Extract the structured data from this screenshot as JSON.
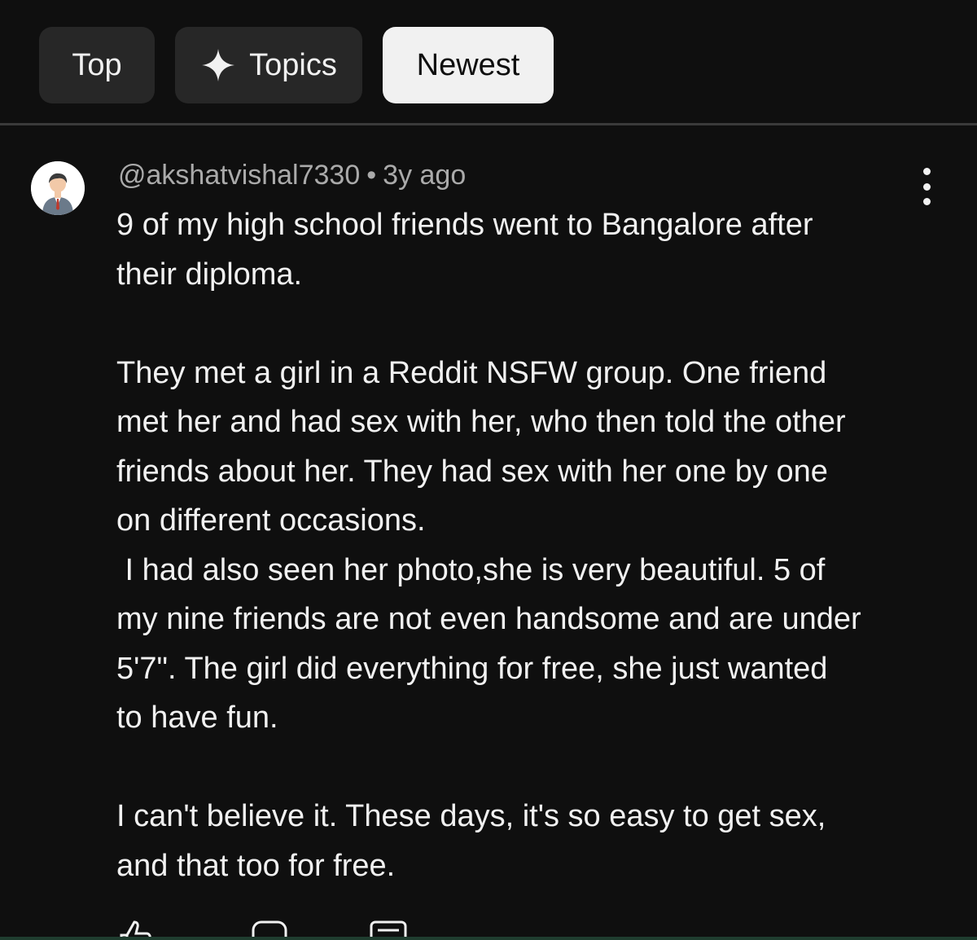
{
  "chips": {
    "top": "Top",
    "topics": "Topics",
    "newest": "Newest"
  },
  "icons": {
    "topics_chip": "sparkle-icon",
    "avatar": "user-avatar",
    "menu": "more-vertical-icon",
    "actions": [
      "thumbs-up-icon",
      "thumbs-down-icon",
      "reply-icon"
    ]
  },
  "comment": {
    "author": "@akshatvishal7330",
    "separator": "•",
    "time": "3y ago",
    "lines": [
      "9 of my high school friends went to Bangalore after",
      "their diploma.",
      "",
      "They met a girl in a Reddit NSFW group. One friend",
      "met her and had sex with her, who then told the other",
      "friends about her. They had sex with her one by one",
      "on different occasions.",
      " I had also seen her photo,she is very beautiful. 5 of",
      "my nine friends are not even handsome and are under",
      "5'7\". The girl did everything for free, she just wanted",
      "to have fun.",
      "",
      "I can't believe it. These days, it's so easy to get sex,",
      "and that too for free."
    ]
  },
  "colors": {
    "background": "#0f0f0f",
    "chip": "#272727",
    "chip_active": "#f1f1f1",
    "text": "#f1f1f1",
    "meta_text": "#aaaaaa"
  }
}
